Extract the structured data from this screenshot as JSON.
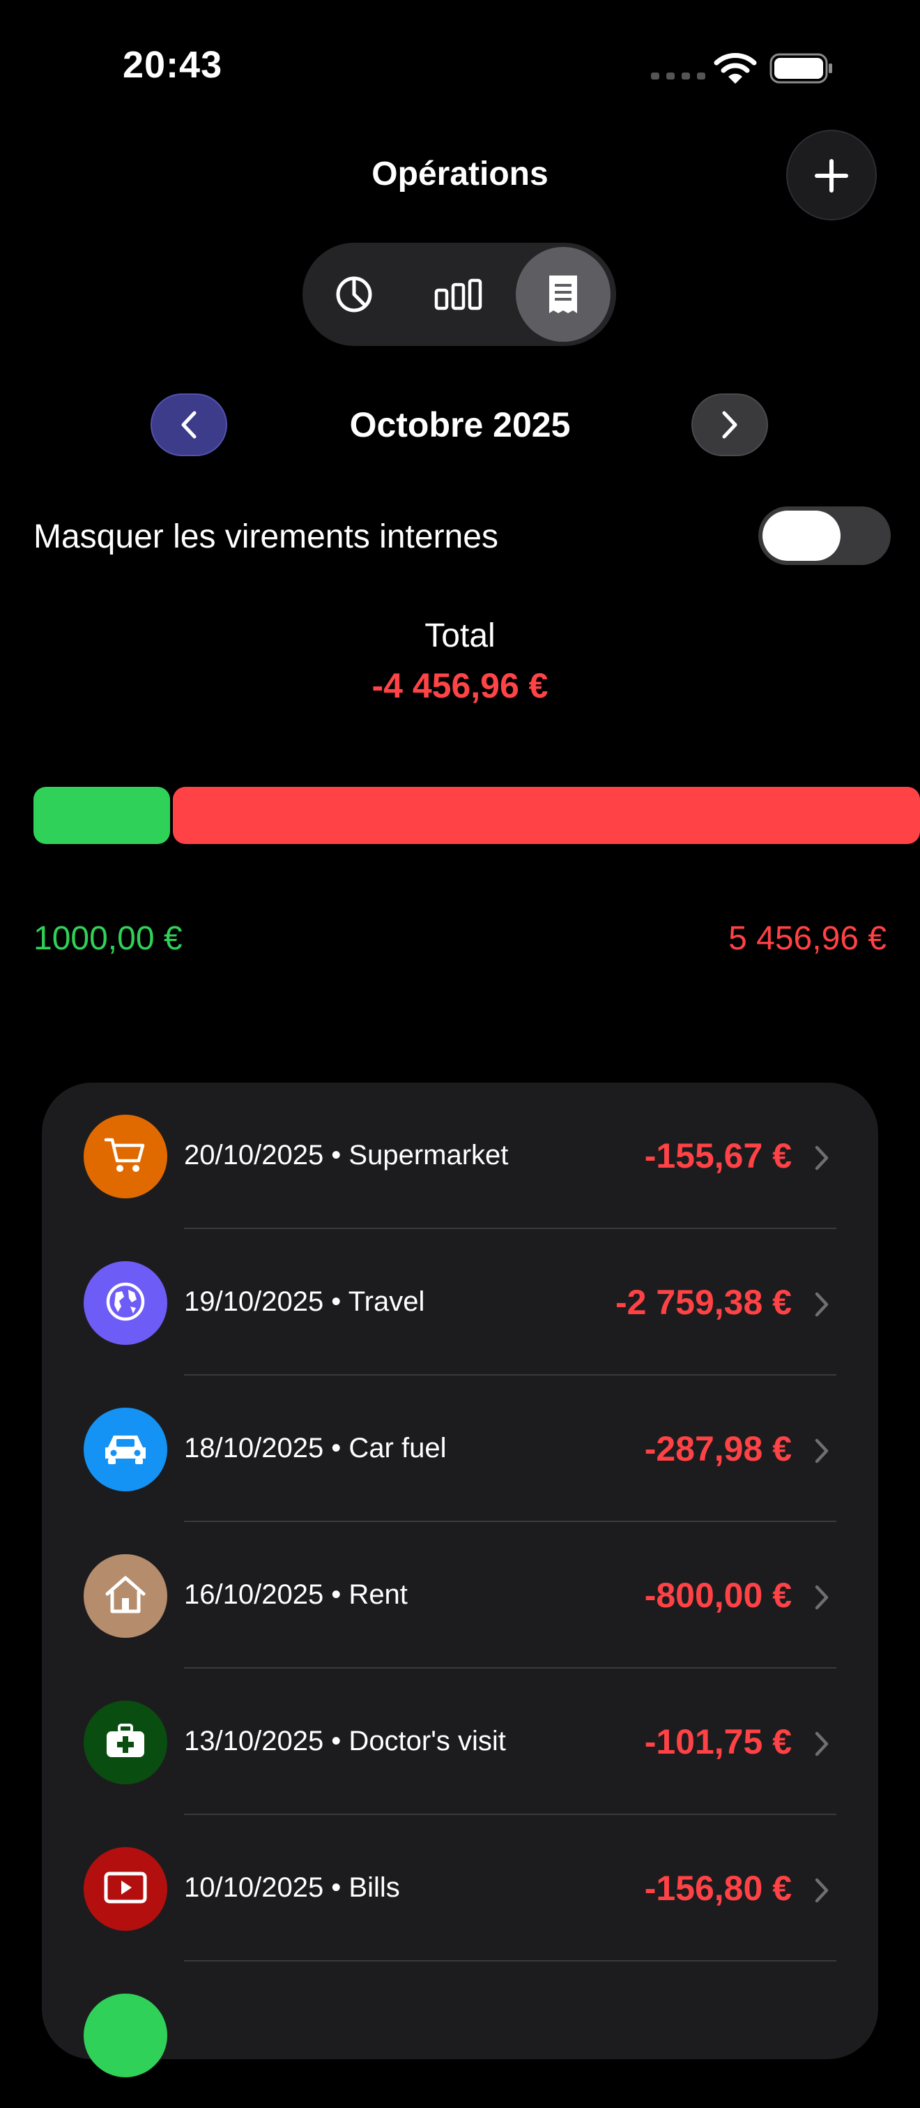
{
  "status_bar": {
    "time": "20:43"
  },
  "header": {
    "title": "Opérations",
    "add_label": "+"
  },
  "view_modes": [
    "pie-chart-icon",
    "bar-chart-icon",
    "receipt-icon"
  ],
  "month_nav": {
    "label": "Octobre 2025"
  },
  "toggle": {
    "label": "Masquer les virements internes",
    "on": false
  },
  "summary": {
    "total_label": "Total",
    "total_value": "-4 456,96 €",
    "income": "1000,00 €",
    "expenses": "5 456,96 €",
    "income_amount": 1000.0,
    "expense_amount": 5456.96
  },
  "colors": {
    "income": "#30d158",
    "expense": "#ff4245",
    "accent": "#3c3c8a"
  },
  "transactions": [
    {
      "label": "20/10/2025 • Supermarket",
      "amount": "-155,67 €",
      "icon": "cart-icon",
      "color": "#e06a00"
    },
    {
      "label": "19/10/2025 • Travel",
      "amount": "-2 759,38 €",
      "icon": "globe-icon",
      "color": "#6e5cf6"
    },
    {
      "label": "18/10/2025 • Car fuel",
      "amount": "-287,98 €",
      "icon": "car-icon",
      "color": "#1493f5"
    },
    {
      "label": "16/10/2025 • Rent",
      "amount": "-800,00 €",
      "icon": "house-icon",
      "color": "#b58c6c"
    },
    {
      "label": "13/10/2025 • Doctor's visit",
      "amount": "-101,75 €",
      "icon": "medical-kit-icon",
      "color": "#0a4d10"
    },
    {
      "label": "10/10/2025 • Bills",
      "amount": "-156,80 €",
      "icon": "play-icon",
      "color": "#b40f0f"
    },
    {
      "label": "",
      "amount": "",
      "icon": "partial-row-icon",
      "color": "#30d158"
    }
  ]
}
